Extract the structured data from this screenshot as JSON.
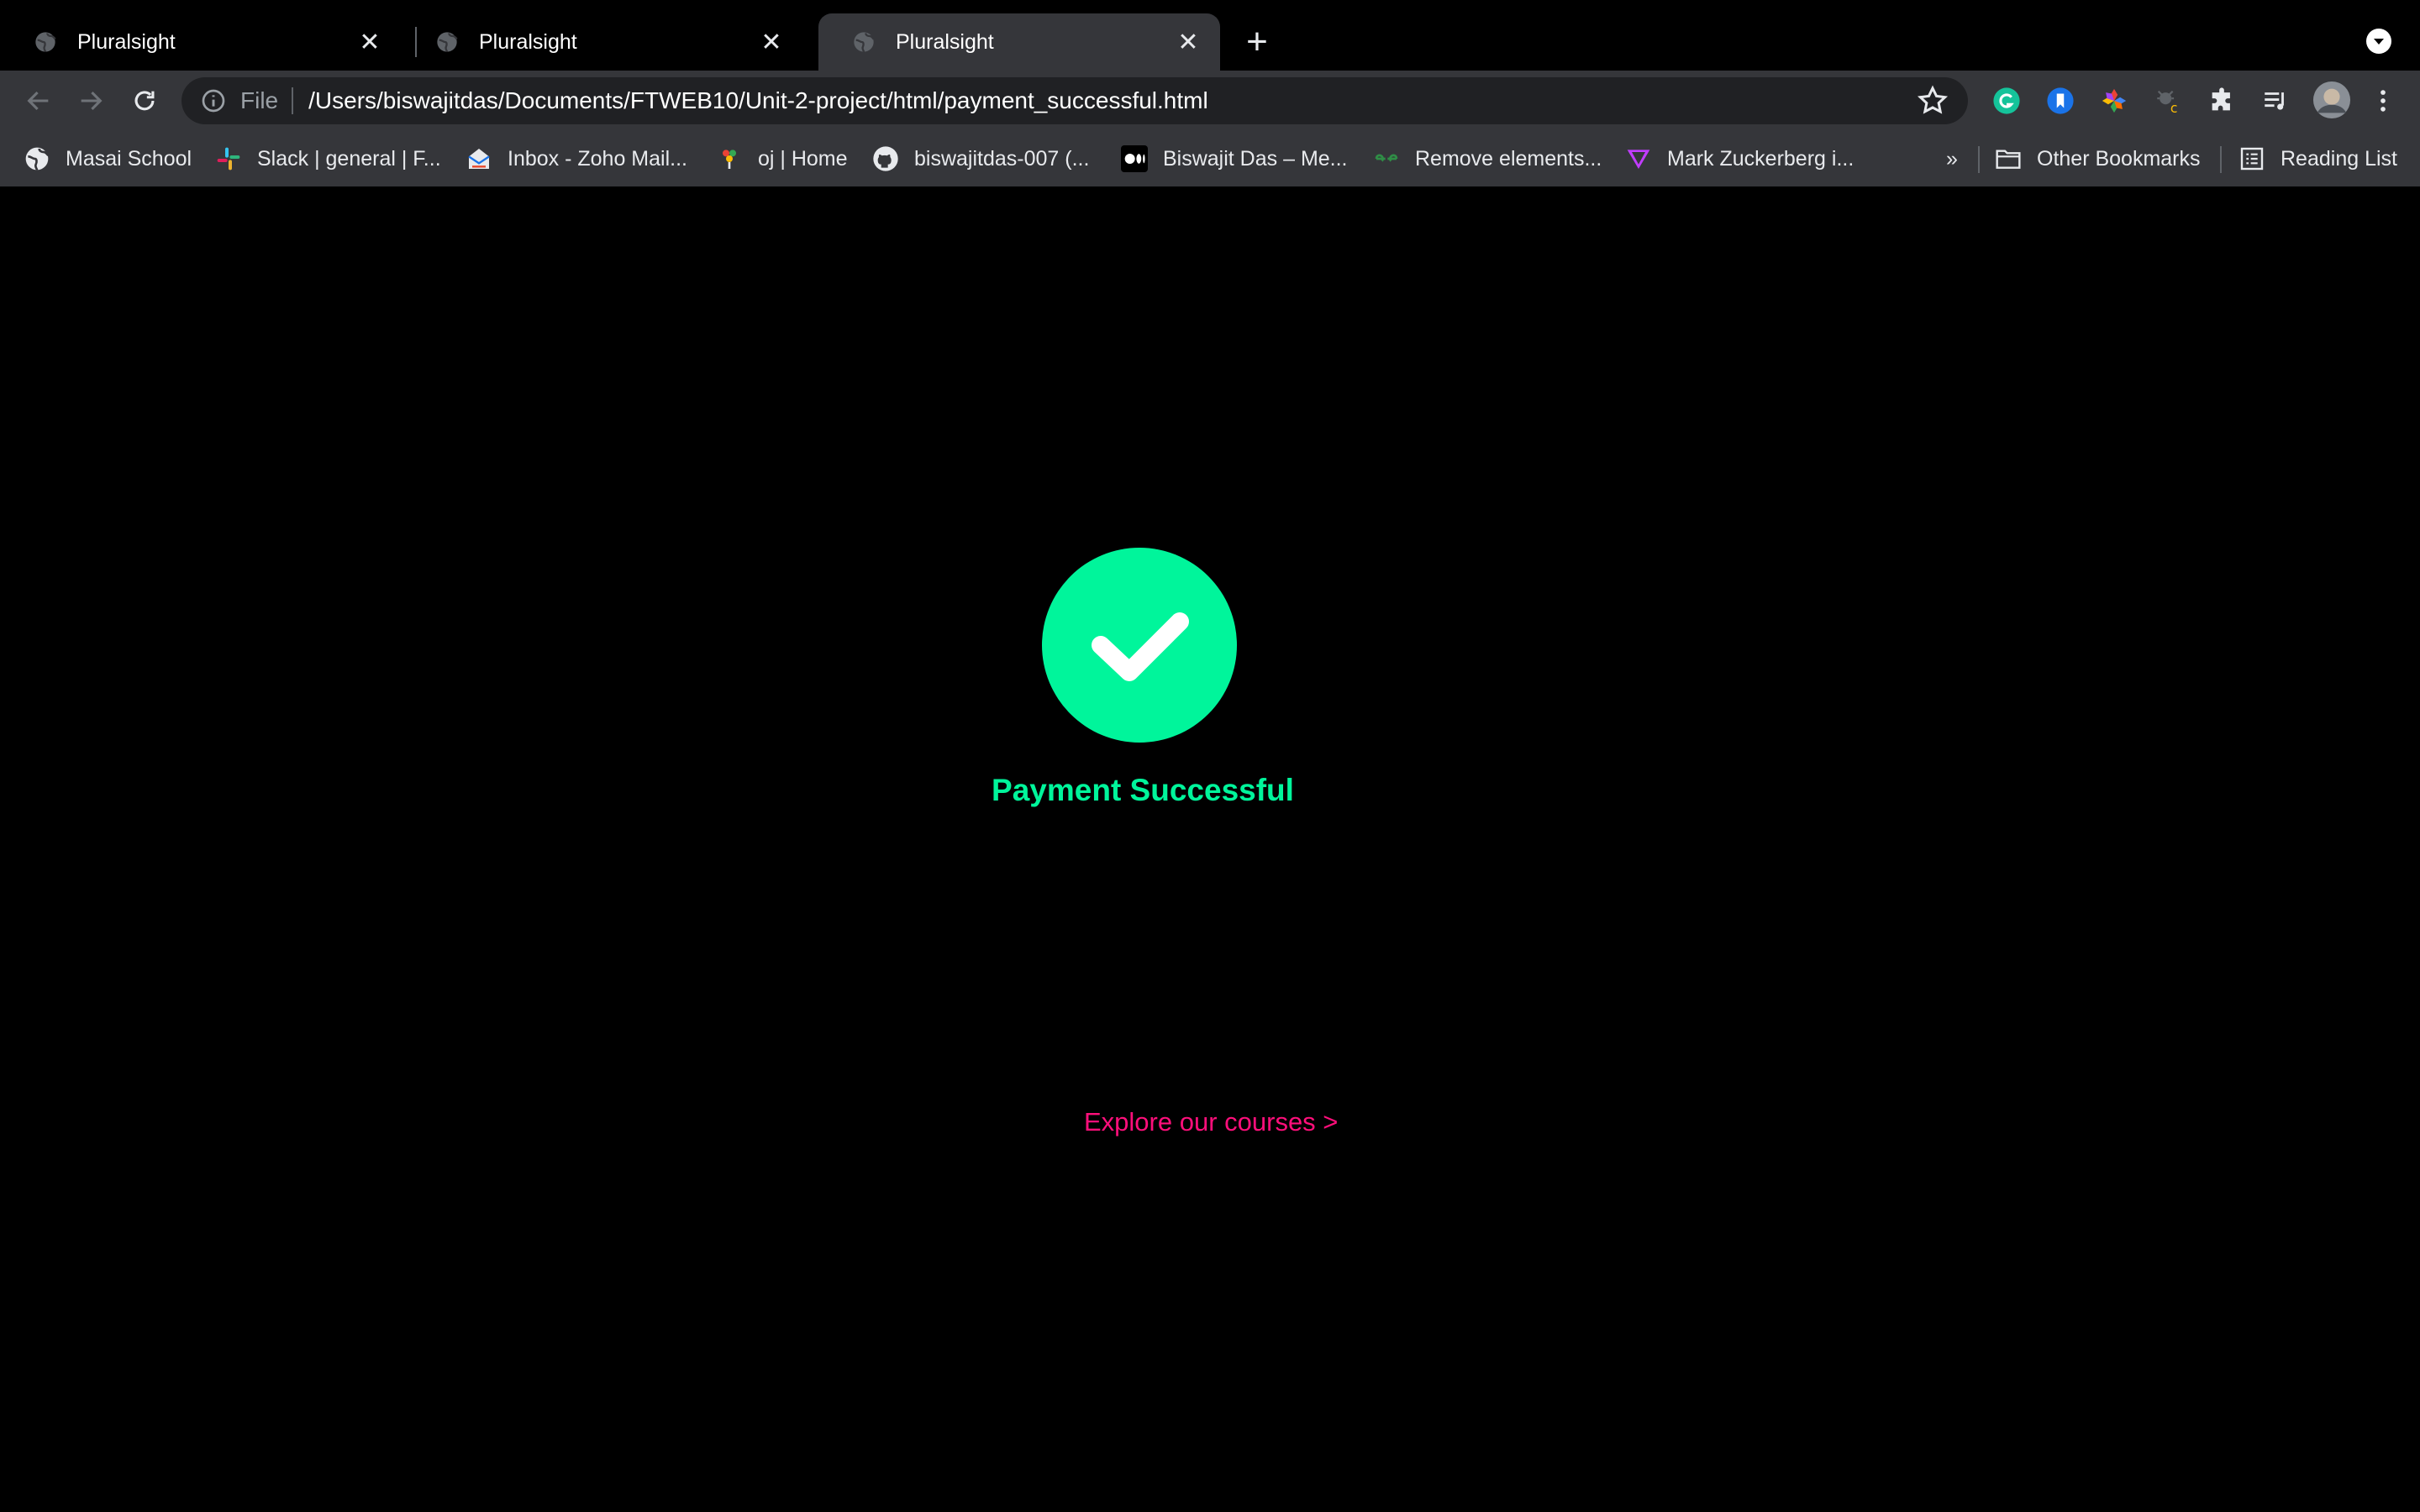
{
  "tabs": [
    {
      "title": "Pluralsight",
      "active": false
    },
    {
      "title": "Pluralsight",
      "active": false
    },
    {
      "title": "Pluralsight",
      "active": true
    }
  ],
  "address_bar": {
    "scheme_label": "File",
    "url": "/Users/biswajitdas/Documents/FTWEB10/Unit-2-project/html/payment_successful.html"
  },
  "bookmarks": [
    {
      "label": "Masai School",
      "icon": "globe-icon"
    },
    {
      "label": "Slack | general | F...",
      "icon": "slack-icon"
    },
    {
      "label": "Inbox - Zoho Mail...",
      "icon": "zoho-mail-icon"
    },
    {
      "label": "oj | Home",
      "icon": "oj-icon"
    },
    {
      "label": "biswajitdas-007 (...",
      "icon": "github-icon"
    },
    {
      "label": "Biswajit Das – Me...",
      "icon": "medium-icon"
    },
    {
      "label": "Remove elements...",
      "icon": "geeksforgeeks-icon"
    },
    {
      "label": "Mark Zuckerberg i...",
      "icon": "vercel-icon"
    }
  ],
  "bookmarks_overflow": "»",
  "other_bookmarks": "Other Bookmarks",
  "reading_list": "Reading List",
  "page": {
    "status_title": "Payment Successful",
    "explore_link": "Explore our courses >"
  },
  "colors": {
    "success": "#00f59b",
    "link": "#ff0f7b",
    "background": "#000000"
  }
}
